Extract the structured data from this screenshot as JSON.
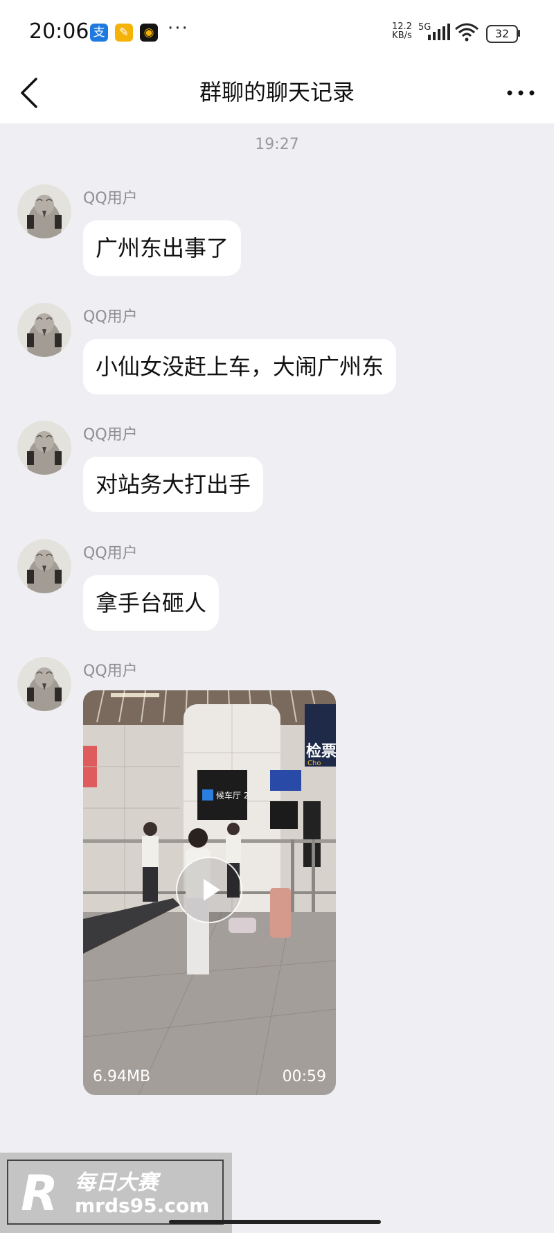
{
  "status_bar": {
    "time": "20:06",
    "more": "···",
    "net_speed_value": "12.2",
    "net_speed_unit": "KB/s",
    "network": "5G",
    "battery": "32",
    "app_icons": [
      {
        "name": "alipay-icon",
        "glyph": "支",
        "color": "#1f7ae0"
      },
      {
        "name": "notes-app-icon",
        "glyph": "✎",
        "color": "#f5b30a"
      },
      {
        "name": "idea-app-icon",
        "glyph": "◉",
        "color": "#141414"
      }
    ]
  },
  "header": {
    "title": "群聊的聊天记录"
  },
  "time_label": "19:27",
  "messages": [
    {
      "sender": "QQ用户",
      "text": "广州东出事了"
    },
    {
      "sender": "QQ用户",
      "text": "小仙女没赶上车，大闹广州东"
    },
    {
      "sender": "QQ用户",
      "text": "对站务大打出手"
    },
    {
      "sender": "QQ用户",
      "text": "拿手台砸人"
    },
    {
      "sender": "QQ用户"
    }
  ],
  "video": {
    "size": "6.94MB",
    "duration": "00:59",
    "gate_sign": "候车厅 2",
    "check_sign": "检票",
    "check_sign_sub": "Cho"
  },
  "watermark": {
    "logo_letter": "R",
    "brand_cn": "每日大赛",
    "url": "mrds95.com"
  }
}
